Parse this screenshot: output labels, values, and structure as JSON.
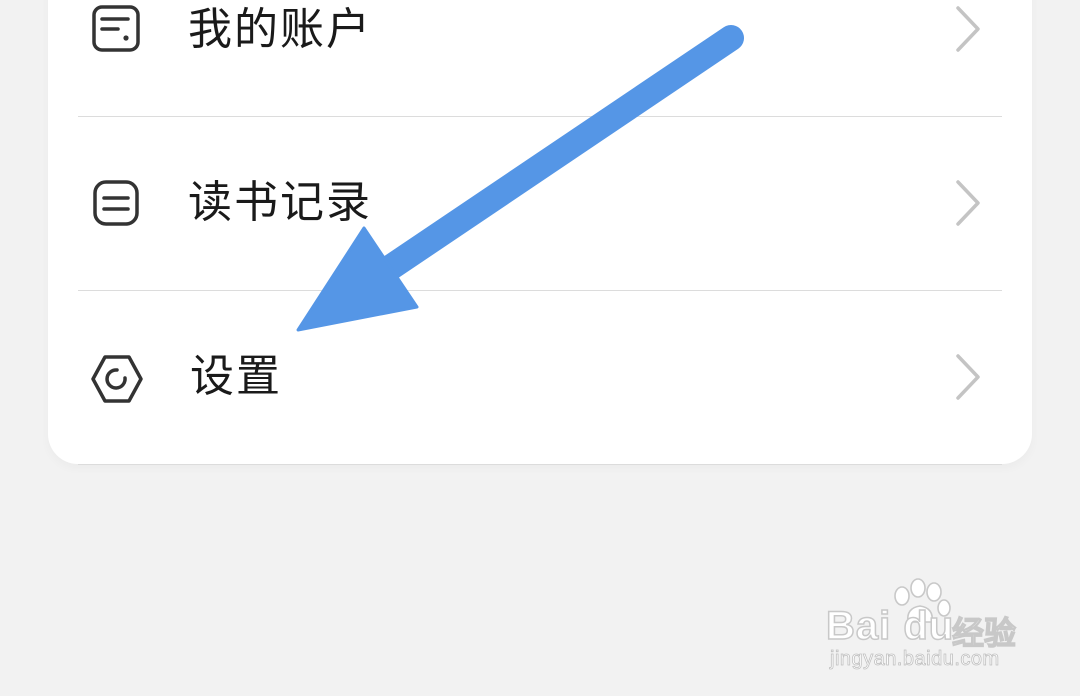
{
  "menu": {
    "items": [
      {
        "label": "我的账户",
        "icon": "wallet-icon"
      },
      {
        "label": "读书记录",
        "icon": "reading-record-icon"
      },
      {
        "label": "设置",
        "icon": "settings-hexagon-icon"
      }
    ]
  },
  "annotation": {
    "arrow_color": "#5596e6"
  },
  "watermark": {
    "brand": "Bai du",
    "sub": "经验",
    "url": "jingyan.baidu.com"
  }
}
